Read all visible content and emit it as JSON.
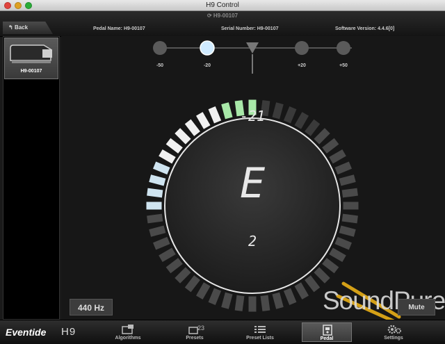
{
  "window": {
    "title": "H9 Control"
  },
  "header": {
    "sync_id": "H9-00107",
    "back_label": "Back",
    "pedal_name": "Pedal Name:   H9-00107",
    "serial_number": "Serial Number:   H9-00107",
    "software_version": "Software Version:   4.4.6[0]"
  },
  "sidebar": {
    "pedal_card_name": "H9-00107"
  },
  "tuner": {
    "cents": "-21",
    "note": "E",
    "octave": "2",
    "scale_labels": [
      "-50",
      "-20",
      "+20",
      "+50"
    ],
    "active_mark": "-20",
    "lit_segments": 12,
    "reference_label": "440 Hz",
    "mute_label": "Mute"
  },
  "watermark": {
    "text": "SoundPure"
  },
  "bottom": {
    "brand": "Eventide",
    "model": "H9",
    "nav": [
      {
        "label": "Algorithms",
        "icon": "algorithms-icon"
      },
      {
        "label": "Presets",
        "icon": "presets-icon"
      },
      {
        "label": "Preset Lists",
        "icon": "preset-lists-icon"
      },
      {
        "label": "Pedal",
        "icon": "pedal-icon",
        "active": true
      },
      {
        "label": "Settings",
        "icon": "settings-icon"
      }
    ]
  },
  "colors": {
    "lit_white": "#f0f0f0",
    "lit_green": "#a8e8a8",
    "unlit": "#4a4a4a",
    "active_dot": "#cfeaff"
  }
}
